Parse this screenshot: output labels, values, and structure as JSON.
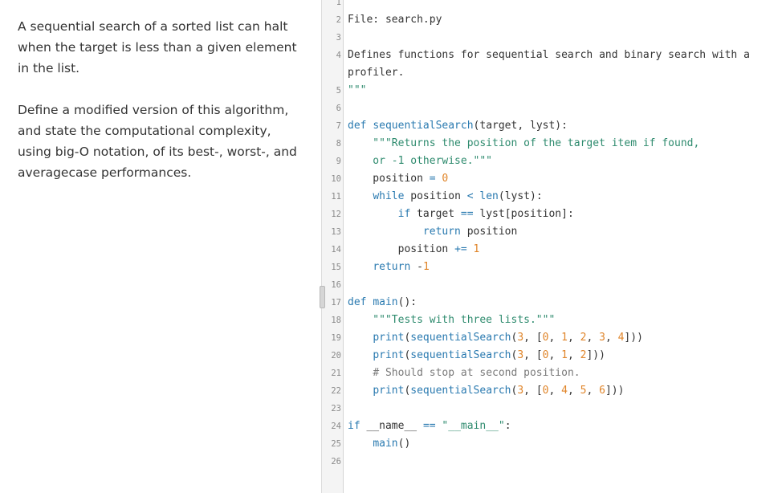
{
  "prompt": {
    "paragraph1": "A sequential search of a sorted list can halt when the target is less than a given element in the list.",
    "paragraph2": "Define a modified version of this algorithm, and state the computational complexity, using big-O notation, of its best-, worst-, and averagecase performances."
  },
  "code_lines": [
    {
      "n": "1",
      "text": ""
    },
    {
      "n": "2",
      "text": "File: search.py"
    },
    {
      "n": "3",
      "text": ""
    },
    {
      "n": "4",
      "text": "Defines functions for sequential search and binary search with a"
    },
    {
      "n": "",
      "text": "profiler."
    },
    {
      "n": "5",
      "text": "\"\"\""
    },
    {
      "n": "6",
      "text": ""
    },
    {
      "n": "7",
      "text": "def sequentialSearch(target, lyst):"
    },
    {
      "n": "8",
      "text": "    \"\"\"Returns the position of the target item if found,"
    },
    {
      "n": "9",
      "text": "    or -1 otherwise.\"\"\""
    },
    {
      "n": "10",
      "text": "    position = 0"
    },
    {
      "n": "11",
      "text": "    while position < len(lyst):"
    },
    {
      "n": "12",
      "text": "        if target == lyst[position]:"
    },
    {
      "n": "13",
      "text": "            return position"
    },
    {
      "n": "14",
      "text": "        position += 1"
    },
    {
      "n": "15",
      "text": "    return -1"
    },
    {
      "n": "16",
      "text": ""
    },
    {
      "n": "17",
      "text": "def main():"
    },
    {
      "n": "18",
      "text": "    \"\"\"Tests with three lists.\"\"\""
    },
    {
      "n": "19",
      "text": "    print(sequentialSearch(3, [0, 1, 2, 3, 4]))"
    },
    {
      "n": "20",
      "text": "    print(sequentialSearch(3, [0, 1, 2]))"
    },
    {
      "n": "21",
      "text": "    # Should stop at second position."
    },
    {
      "n": "22",
      "text": "    print(sequentialSearch(3, [0, 4, 5, 6]))"
    },
    {
      "n": "23",
      "text": ""
    },
    {
      "n": "24",
      "text": "if __name__ == \"__main__\":"
    },
    {
      "n": "25",
      "text": "    main()"
    },
    {
      "n": "26",
      "text": ""
    }
  ],
  "colors": {
    "keyword": "#2a7ab0",
    "string": "#2e8b6e",
    "number": "#e0852a",
    "comment": "#7a7a7a",
    "text": "#333333"
  }
}
